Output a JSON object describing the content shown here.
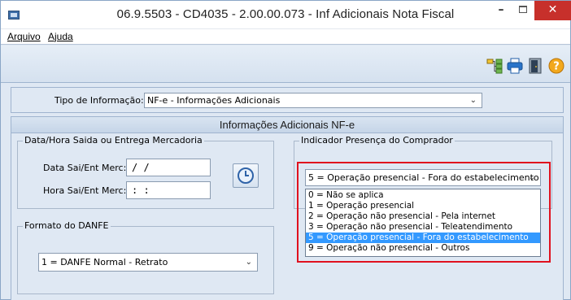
{
  "window": {
    "title": "06.9.5503 - CD4035 - 2.00.00.073 - Inf Adicionais Nota Fiscal",
    "minimize": "–",
    "close": "✕"
  },
  "menu": {
    "items": [
      "Arquivo",
      "Ajuda"
    ]
  },
  "toolbar": {
    "icons": [
      "tree-structure-icon",
      "printer-icon",
      "exit-door-icon",
      "help-icon"
    ]
  },
  "tipo": {
    "label": "Tipo de Informação:",
    "value": "NF-e - Informações Adicionais"
  },
  "main": {
    "header": "Informações Adicionais NF-e",
    "data_group": {
      "legend": "Data/Hora Saida ou Entrega Mercadoria",
      "data_label": "Data Sai/Ent Merc:",
      "data_value": " / /",
      "hora_label": "Hora Sai/Ent Merc:",
      "hora_value": " : :"
    },
    "presenca_group": {
      "legend": "Indicador Presença do Comprador",
      "selected": "5 = Operação presencial - Fora do estabelecimento",
      "options": [
        "0 = Não se aplica",
        "1 = Operação presencial",
        "2 = Operação não presencial - Pela internet",
        "3 = Operação não presencial - Teleatendimento",
        "5 = Operação presencial - Fora do estabelecimento",
        "9 = Operação não presencial - Outros"
      ],
      "highlighted_index": 4
    },
    "formato_group": {
      "legend": "Formato do DANFE",
      "value": "1 = DANFE Normal - Retrato"
    }
  },
  "colors": {
    "selection": "#3399ff",
    "highlight_frame": "#e0111e",
    "close_button": "#c7302b"
  }
}
